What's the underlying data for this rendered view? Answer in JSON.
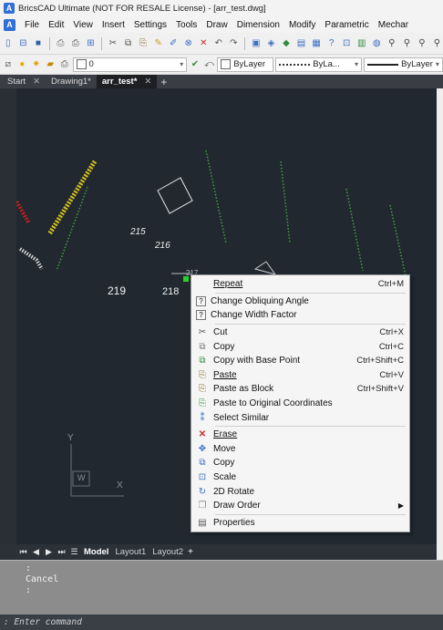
{
  "window": {
    "title": "BricsCAD Ultimate (NOT FOR RESALE License) - [arr_test.dwg]",
    "app_icon_letter": "A"
  },
  "menubar": {
    "items": [
      "File",
      "Edit",
      "View",
      "Insert",
      "Settings",
      "Tools",
      "Draw",
      "Dimension",
      "Modify",
      "Parametric",
      "Mechar"
    ]
  },
  "properties_bar": {
    "layer_value": "0",
    "color_value": "ByLayer",
    "linetype_value": "ByLa...",
    "lineweight_value": "ByLayer"
  },
  "doc_tabs": [
    {
      "label": "Start",
      "active": false
    },
    {
      "label": "Drawing1*",
      "active": false
    },
    {
      "label": "arr_test*",
      "active": true
    }
  ],
  "drawing": {
    "labels": [
      "215",
      "216",
      "219",
      "218",
      "217"
    ]
  },
  "context_menu": {
    "items": [
      {
        "label": "Repeat",
        "shortcut": "Ctrl+M",
        "icon": "none"
      },
      {
        "label": "Change Obliquing Angle",
        "shortcut": "",
        "icon": "help-icon"
      },
      {
        "label": "Change Width Factor",
        "shortcut": "",
        "icon": "help-icon"
      },
      {
        "label": "Cut",
        "shortcut": "Ctrl+X",
        "icon": "scissors-icon"
      },
      {
        "label": "Copy",
        "shortcut": "Ctrl+C",
        "icon": "copy-icon"
      },
      {
        "label": "Copy with Base Point",
        "shortcut": "Ctrl+Shift+C",
        "icon": "copy-base-icon"
      },
      {
        "label": "Paste",
        "shortcut": "Ctrl+V",
        "icon": "paste-icon"
      },
      {
        "label": "Paste as Block",
        "shortcut": "Ctrl+Shift+V",
        "icon": "paste-block-icon"
      },
      {
        "label": "Paste to Original Coordinates",
        "shortcut": "",
        "icon": "paste-orig-icon"
      },
      {
        "label": "Select Similar",
        "shortcut": "",
        "icon": "select-similar-icon"
      },
      {
        "label": "Erase",
        "shortcut": "",
        "icon": "erase-icon"
      },
      {
        "label": "Move",
        "shortcut": "",
        "icon": "move-icon"
      },
      {
        "label": "Copy",
        "shortcut": "",
        "icon": "copy-entity-icon"
      },
      {
        "label": "Scale",
        "shortcut": "",
        "icon": "scale-icon"
      },
      {
        "label": "2D Rotate",
        "shortcut": "",
        "icon": "rotate-icon"
      },
      {
        "label": "Draw Order",
        "shortcut": "",
        "icon": "draw-order-icon",
        "submenu": true
      },
      {
        "label": "Properties",
        "shortcut": "",
        "icon": "properties-icon"
      }
    ]
  },
  "layout_tabs": [
    {
      "label": "Model",
      "active": true
    },
    {
      "label": "Layout1",
      "active": false
    },
    {
      "label": "Layout2",
      "active": false
    }
  ],
  "command": {
    "history": [
      ":",
      "Cancel",
      ":"
    ],
    "placeholder": ": Enter command"
  },
  "colors": {
    "canvas_bg": "#212830",
    "accent_blue": "#2f6fd6",
    "green_dots": "#3fa33f",
    "yellow_hatch": "#d6c21a",
    "red_hatch": "#c21f1f"
  }
}
